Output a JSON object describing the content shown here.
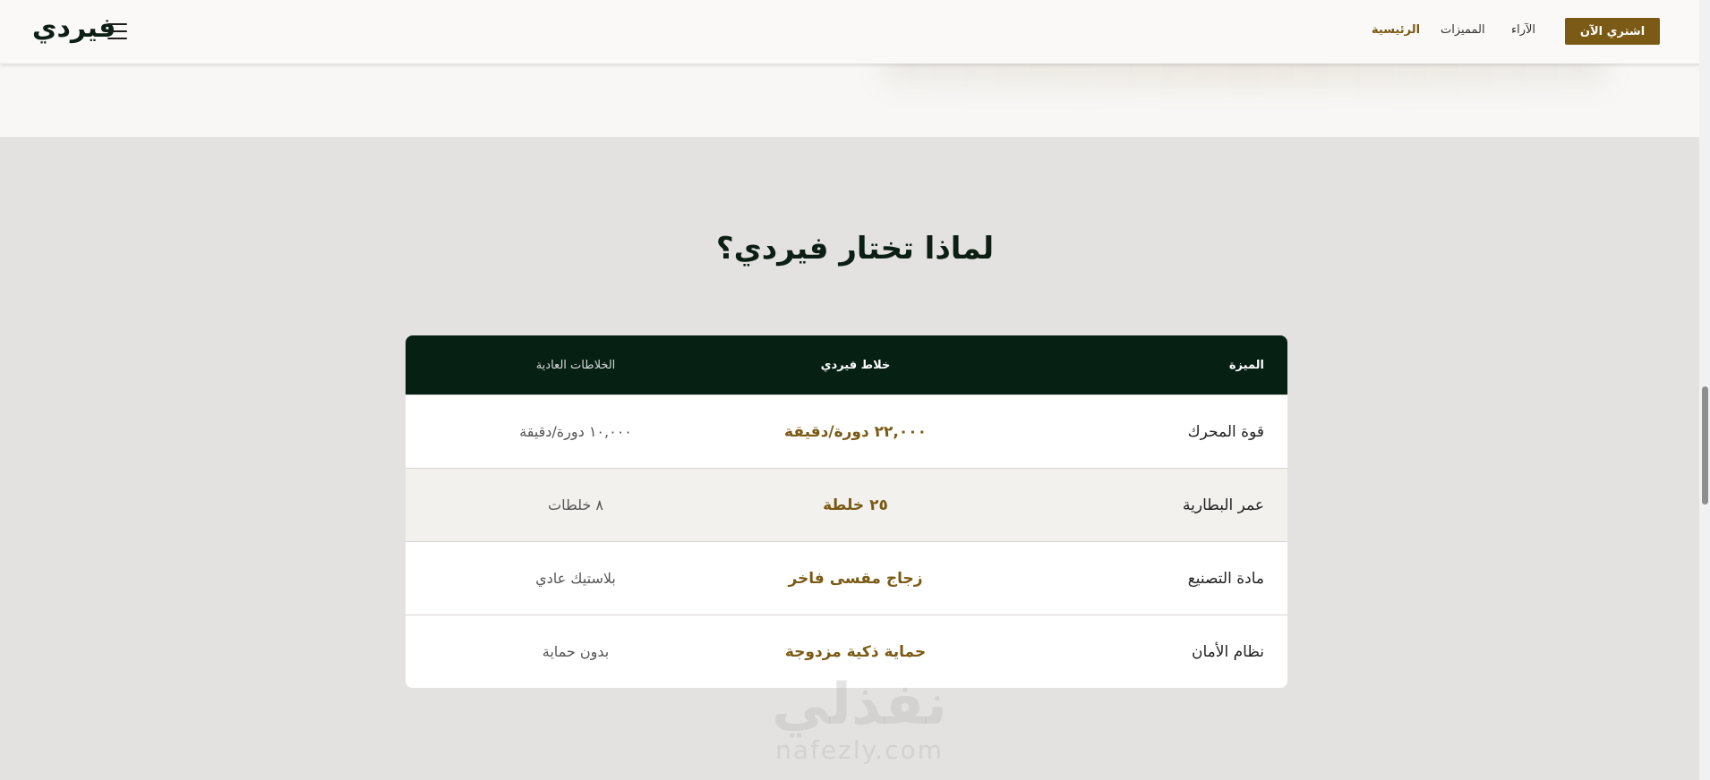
{
  "header": {
    "brand": "فيردي",
    "buy_label": "اشتري الآن",
    "nav": {
      "home": "الرئيسية",
      "features": "المميزات",
      "reviews": "الآراء"
    }
  },
  "section": {
    "title": "لماذا تختار فيردي؟"
  },
  "table": {
    "headers": {
      "feature": "الميزة",
      "ferdi": "خلاط فيردي",
      "normal": "الخلاطات العادية"
    },
    "rows": [
      {
        "feature": "قوة المحرك",
        "ferdi": "٢٢,٠٠٠ دورة/دقيقة",
        "normal": "١٠,٠٠٠ دورة/دقيقة"
      },
      {
        "feature": "عمر البطارية",
        "ferdi": "٢٥ خلطة",
        "normal": "٨ خلطات"
      },
      {
        "feature": "مادة التصنيع",
        "ferdi": "زجاج مقسى فاخر",
        "normal": "بلاستيك عادي"
      },
      {
        "feature": "نظام الأمان",
        "ferdi": "حماية ذكية مزدوجة",
        "normal": "بدون حماية"
      }
    ]
  },
  "watermark": {
    "arabic": "نفذلي",
    "latin": "nafezly.com"
  },
  "colors": {
    "accent": "#7a5a14",
    "table_header_bg": "#062014",
    "page_bg": "#e3e2e0"
  }
}
